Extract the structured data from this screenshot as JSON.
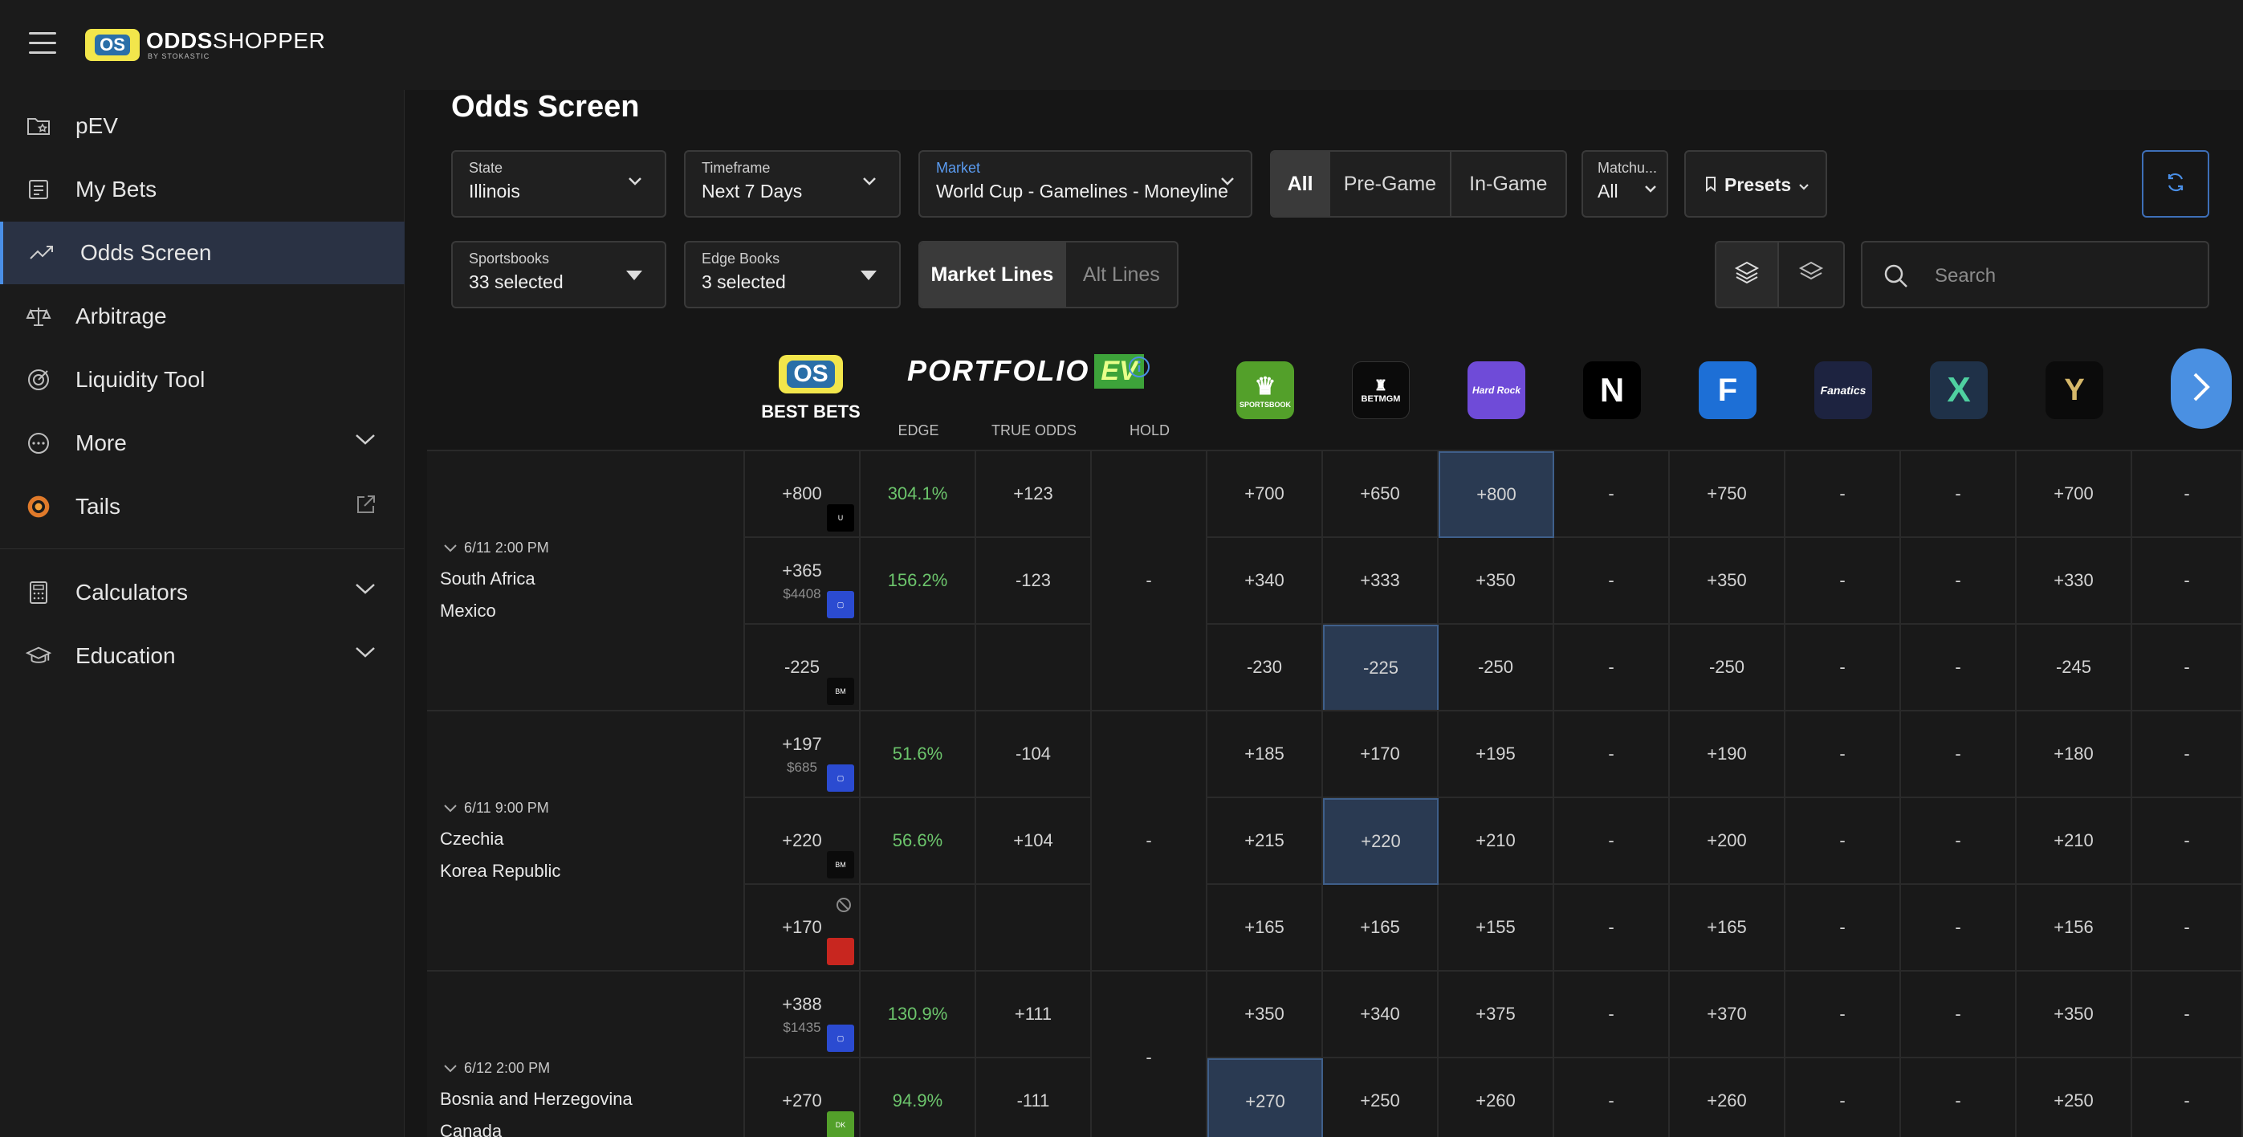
{
  "brand": {
    "logo_badge": "OS",
    "name_bold": "ODDS",
    "name_thin": "SHOPPER",
    "byline": "BY STOKASTIC"
  },
  "sidebar": {
    "items": [
      {
        "label": "pEV",
        "icon": "folder-star-icon"
      },
      {
        "label": "My Bets",
        "icon": "receipt-icon"
      },
      {
        "label": "Odds Screen",
        "icon": "trend-icon",
        "active": true
      },
      {
        "label": "Arbitrage",
        "icon": "scale-icon"
      },
      {
        "label": "Liquidity Tool",
        "icon": "target-icon"
      },
      {
        "label": "More",
        "icon": "more-icon"
      },
      {
        "label": "Tails",
        "icon": "tails-logo-icon"
      }
    ],
    "items2": [
      {
        "label": "Calculators",
        "icon": "calculator-icon"
      },
      {
        "label": "Education",
        "icon": "graduation-cap-icon"
      }
    ]
  },
  "page": {
    "title": "Odds Screen"
  },
  "filters": {
    "state": {
      "label": "State",
      "value": "Illinois"
    },
    "timeframe": {
      "label": "Timeframe",
      "value": "Next 7 Days"
    },
    "market": {
      "label": "Market",
      "value": "World Cup - Gamelines - Moneyline"
    },
    "game_state": {
      "options": [
        "All",
        "Pre-Game",
        "In-Game"
      ],
      "selected": "All"
    },
    "matchup": {
      "label": "Matchu...",
      "value": "All"
    },
    "presets": {
      "label": "Presets"
    },
    "sportsbooks": {
      "label": "Sportsbooks",
      "value": "33 selected"
    },
    "edge_books": {
      "label": "Edge Books",
      "value": "3 selected"
    },
    "lines": {
      "options": [
        "Market Lines",
        "Alt Lines"
      ],
      "selected": "Market Lines"
    },
    "search": {
      "placeholder": "Search"
    }
  },
  "columns": {
    "best_bets": {
      "badge": "OS",
      "label": "BEST BETS"
    },
    "portfolio": {
      "label": "PORTFOLIO",
      "badge": "EV"
    },
    "edge": "EDGE",
    "true_odds": "TRUE ODDS",
    "hold": "HOLD",
    "books": [
      {
        "name": "DraftKings",
        "short": "SPORTSBOOK",
        "color": "#53a02a"
      },
      {
        "name": "BetMGM",
        "short": "BETMGM",
        "color": "#0b0b0b"
      },
      {
        "name": "Hard Rock Bet",
        "short": "Hard Rock",
        "color": "#6f4bd8"
      },
      {
        "name": "Novig",
        "short": "N",
        "color": "#000000"
      },
      {
        "name": "FanDuel",
        "short": "F",
        "color": "#1d6fd6"
      },
      {
        "name": "Fanatics",
        "short": "Fanatics",
        "color": "#1d2340"
      },
      {
        "name": "Kalshi",
        "short": "X",
        "color": "#1f3148"
      },
      {
        "name": "Caesars",
        "short": "Y",
        "color": "#0b0b0b"
      }
    ]
  },
  "games": [
    {
      "time": "6/11 2:00 PM",
      "teams": [
        "South Africa",
        "Mexico"
      ],
      "hold": "-",
      "rows": [
        {
          "best": "+800",
          "stake": "",
          "edge": "304.1%",
          "true": "+123",
          "book_color": "#000000",
          "book_tag": "U",
          "books": [
            "+700",
            "+650",
            "+800",
            "-",
            "+750",
            "-",
            "-",
            "+700",
            "-"
          ],
          "hl": 2
        },
        {
          "best": "+365",
          "stake": "$4408",
          "edge": "156.2%",
          "true": "-123",
          "book_color": "#2b4bd1",
          "book_tag": "▢",
          "books": [
            "+340",
            "+333",
            "+350",
            "-",
            "+350",
            "-",
            "-",
            "+330",
            "-"
          ],
          "hl": -1
        },
        {
          "best": "-225",
          "stake": "",
          "edge": "",
          "true": "",
          "book_color": "#0b0b0b",
          "book_tag": "BM",
          "books": [
            "-230",
            "-225",
            "-250",
            "-",
            "-250",
            "-",
            "-",
            "-245",
            "-"
          ],
          "hl": 1
        }
      ]
    },
    {
      "time": "6/11 9:00 PM",
      "teams": [
        "Czechia",
        "Korea Republic"
      ],
      "hold": "-",
      "rows": [
        {
          "best": "+197",
          "stake": "$685",
          "edge": "51.6%",
          "true": "-104",
          "book_color": "#2b4bd1",
          "book_tag": "▢",
          "books": [
            "+185",
            "+170",
            "+195",
            "-",
            "+190",
            "-",
            "-",
            "+180",
            "-"
          ],
          "hl": -1
        },
        {
          "best": "+220",
          "stake": "",
          "edge": "56.6%",
          "true": "+104",
          "book_color": "#0b0b0b",
          "book_tag": "BM",
          "books": [
            "+215",
            "+220",
            "+210",
            "-",
            "+200",
            "-",
            "-",
            "+210",
            "-"
          ],
          "hl": 1
        },
        {
          "best": "+170",
          "stake": "",
          "edge": "",
          "true": "",
          "book_color": "#c8261f",
          "book_tag": "",
          "books": [
            "+165",
            "+165",
            "+155",
            "-",
            "+165",
            "-",
            "-",
            "+156",
            "-"
          ],
          "hl": -1,
          "blocked": true
        }
      ]
    },
    {
      "time": "6/12 2:00 PM",
      "teams": [
        "Bosnia and Herzegovina",
        "Canada"
      ],
      "hold": "-",
      "rows": [
        {
          "best": "+388",
          "stake": "$1435",
          "edge": "130.9%",
          "true": "+111",
          "book_color": "#2b4bd1",
          "book_tag": "▢",
          "books": [
            "+350",
            "+340",
            "+375",
            "-",
            "+370",
            "-",
            "-",
            "+350",
            "-"
          ],
          "hl": -1
        },
        {
          "best": "+270",
          "stake": "",
          "edge": "94.9%",
          "true": "-111",
          "book_color": "#53a02a",
          "book_tag": "DK",
          "books": [
            "+270",
            "+250",
            "+260",
            "-",
            "+260",
            "-",
            "-",
            "+250",
            "-"
          ],
          "hl": 0
        }
      ]
    }
  ]
}
